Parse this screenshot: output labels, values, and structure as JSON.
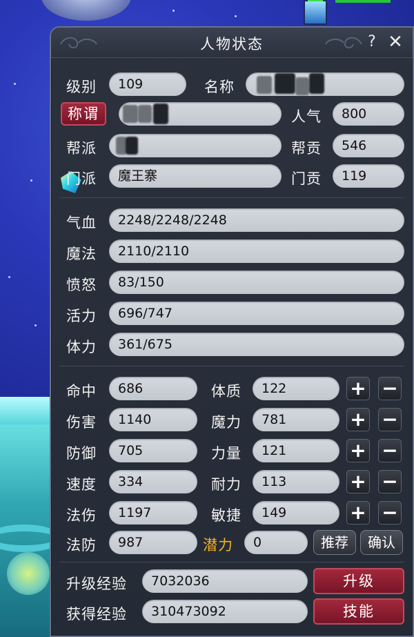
{
  "window": {
    "title": "人物状态",
    "help_icon": "?",
    "close_icon": "✕"
  },
  "profile": {
    "level_label": "级别",
    "level_value": "109",
    "name_label": "名称",
    "title_button": "称谓",
    "popularity_label": "人气",
    "popularity_value": "800",
    "gang_label": "帮派",
    "gang_contrib_label": "帮贡",
    "gang_contrib_value": "546",
    "sect_label": "门派",
    "sect_value": "魔王寨",
    "sect_contrib_label": "门贡",
    "sect_contrib_value": "119"
  },
  "vitals": [
    {
      "label": "气血",
      "value": "2248/2248/2248"
    },
    {
      "label": "魔法",
      "value": "2110/2110"
    },
    {
      "label": "愤怒",
      "value": "83/150"
    },
    {
      "label": "活力",
      "value": "696/747"
    },
    {
      "label": "体力",
      "value": "361/675"
    }
  ],
  "combat_stats": [
    {
      "label": "命中",
      "value": "686"
    },
    {
      "label": "伤害",
      "value": "1140"
    },
    {
      "label": "防御",
      "value": "705"
    },
    {
      "label": "速度",
      "value": "334"
    },
    {
      "label": "法伤",
      "value": "1197"
    },
    {
      "label": "法防",
      "value": "987"
    }
  ],
  "attributes": [
    {
      "label": "体质",
      "value": "122"
    },
    {
      "label": "魔力",
      "value": "781"
    },
    {
      "label": "力量",
      "value": "121"
    },
    {
      "label": "耐力",
      "value": "113"
    },
    {
      "label": "敏捷",
      "value": "149"
    }
  ],
  "potential": {
    "label": "潜力",
    "value": "0",
    "recommend_button": "推荐",
    "confirm_button": "确认"
  },
  "controls": {
    "plus": "+",
    "minus": "−"
  },
  "experience": {
    "upgrade_label": "升级经验",
    "upgrade_value": "7032036",
    "upgrade_button": "升级",
    "gained_label": "获得经验",
    "gained_value": "310473092",
    "skills_button": "技能"
  },
  "colors": {
    "panel": "#2b313d",
    "field": "#cfd4db",
    "accent_red": "#8c1e31",
    "gold": "#f5b21e"
  }
}
